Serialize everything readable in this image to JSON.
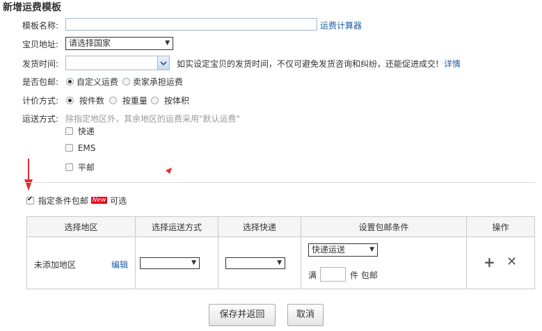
{
  "title": "新增运费模板",
  "template_name": {
    "label": "模板名称:",
    "value": "",
    "link": "运费计算器"
  },
  "ship_from": {
    "label": "宝贝地址:",
    "selected": "请选择国家"
  },
  "ship_time": {
    "label": "发货时间:",
    "selected": "",
    "hint": "如实设定宝贝的发货时间，不仅可避免发货咨询和纠纷，还能促进成交!",
    "link": "详情"
  },
  "free_shipping": {
    "label": "是否包邮:",
    "options": [
      "自定义运费",
      "卖家承担运费"
    ],
    "selected": 0
  },
  "pricing": {
    "label": "计价方式:",
    "options": [
      "按件数",
      "按重量",
      "按体积"
    ],
    "selected": 0
  },
  "delivery": {
    "label": "运送方式:",
    "hint": "除指定地区外，其余地区的运费采用\"默认运费\"",
    "methods": [
      "快递",
      "EMS",
      "平邮"
    ]
  },
  "conditional_free": {
    "label": "指定条件包邮",
    "badge": "New",
    "suffix": "可选",
    "checked": true
  },
  "rules_table": {
    "headers": [
      "选择地区",
      "选择运送方式",
      "选择快递",
      "设置包邮条件",
      "操作"
    ],
    "row": {
      "region": "未添加地区",
      "edit": "编辑",
      "shipping_method": "",
      "courier": "",
      "condition_type": "快递运送",
      "prefix": "满",
      "quantity": "",
      "suffix": "件 包邮"
    },
    "actions": {
      "add": "+",
      "remove": "✕"
    }
  },
  "buttons": {
    "save": "保存并返回",
    "cancel": "取消"
  },
  "colors": {
    "link": "#1c5fa8",
    "badge": "#e3001b",
    "arrow": "#e8282b"
  }
}
